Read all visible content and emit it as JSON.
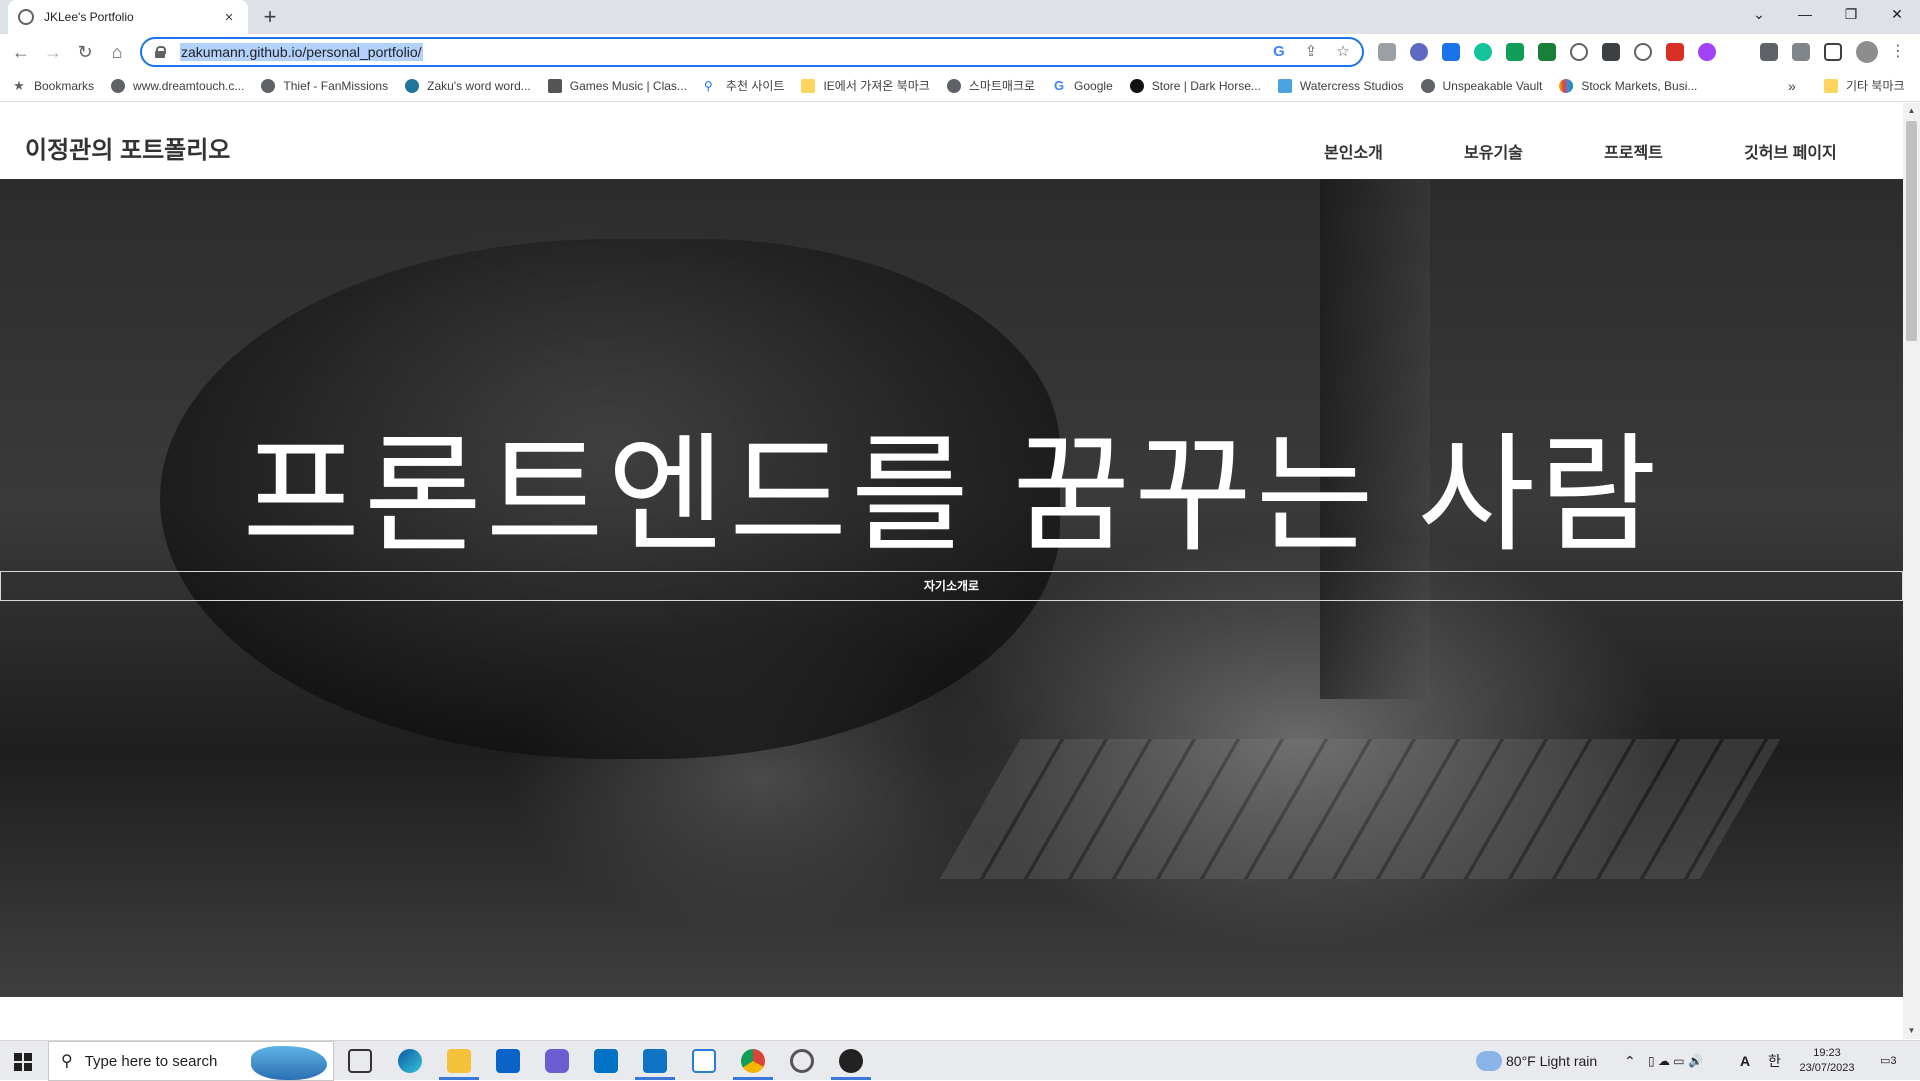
{
  "browser": {
    "tab_title": "JKLee's Portfolio",
    "tab_close": "×",
    "new_tab": "+",
    "url": "zakumann.github.io/personal_portfolio/",
    "window_controls": {
      "dropdown": "⌄",
      "minimize": "—",
      "restore": "❐",
      "close": "✕"
    },
    "nav": {
      "back": "←",
      "forward": "→",
      "reload": "↻",
      "home": "⌂"
    },
    "omnibox_icons": {
      "google": "G",
      "share": "⇪",
      "bookmark": "☆"
    }
  },
  "bookmarks": {
    "items": [
      {
        "label": "Bookmarks",
        "icon": "star-icon"
      },
      {
        "label": "www.dreamtouch.c...",
        "icon": "globe-icon"
      },
      {
        "label": "Thief - FanMissions",
        "icon": "globe-icon"
      },
      {
        "label": "Zaku's word word...",
        "icon": "wordpress-icon"
      },
      {
        "label": "Games Music | Clas...",
        "icon": "site-icon"
      },
      {
        "label": "추천 사이트",
        "icon": "search-icon"
      },
      {
        "label": "IE에서 가져온 북마크",
        "icon": "folder-icon"
      },
      {
        "label": "스마트매크로",
        "icon": "globe-icon"
      },
      {
        "label": "Google",
        "icon": "google-icon"
      },
      {
        "label": "Store | Dark Horse...",
        "icon": "darkhorse-icon"
      },
      {
        "label": "Watercress Studios",
        "icon": "site-icon"
      },
      {
        "label": "Unspeakable Vault",
        "icon": "globe-icon"
      },
      {
        "label": "Stock Markets, Busi...",
        "icon": "cnbc-icon"
      }
    ],
    "more": "»",
    "other": "기타 북마크"
  },
  "site": {
    "brand": "이정관의 포트폴리오",
    "nav": [
      "본인소개",
      "보유기술",
      "프로젝트",
      "깃허브 페이지"
    ],
    "hero_title": "프론트엔드를 꿈꾸는 사람",
    "hero_button": "자기소개로"
  },
  "taskbar": {
    "search_placeholder": "Type here to search",
    "weather": "80°F  Light rain",
    "ime": "A",
    "lang": "한",
    "time": "19:23",
    "date": "23/07/2023",
    "notifications": "3"
  },
  "colors": {
    "accent": "#1a73e8",
    "url_highlight": "#b3d1fb"
  }
}
